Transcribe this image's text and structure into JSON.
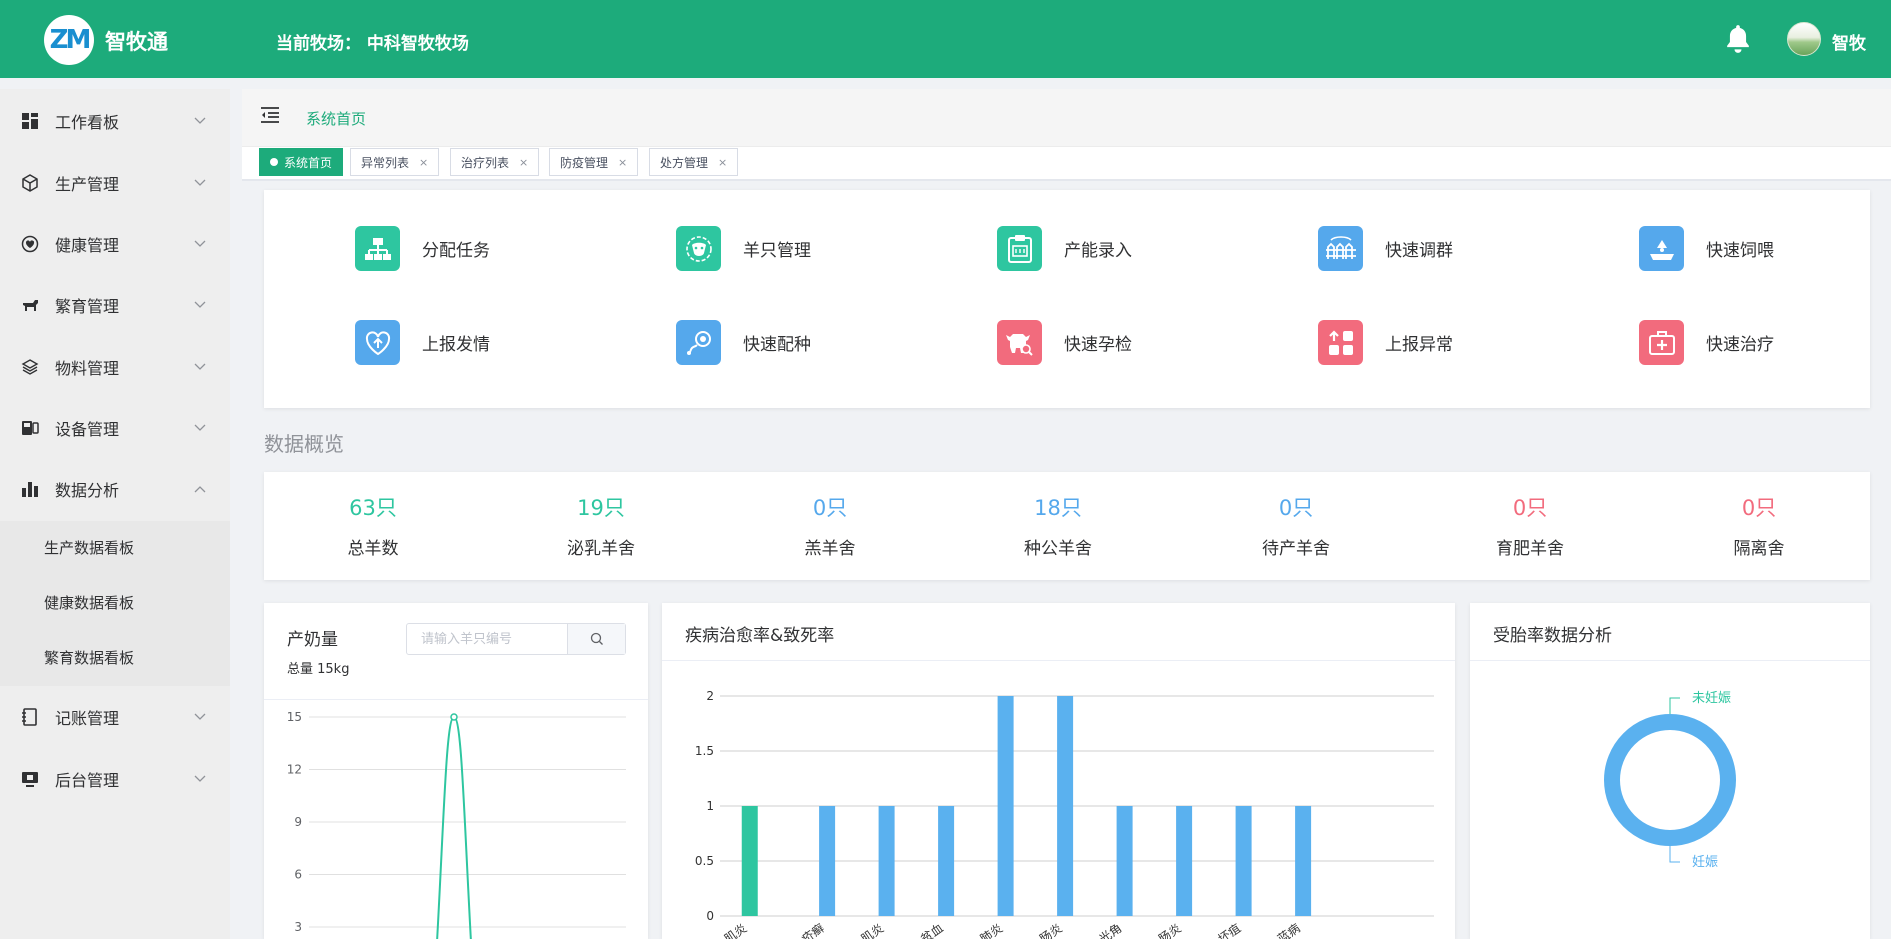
{
  "header": {
    "logo_text": "ZM",
    "app_name": "智牧通",
    "farm_label": "当前牧场：",
    "farm_name": "中科智牧牧场",
    "user_name": "智牧"
  },
  "sidebar": {
    "items": [
      {
        "label": "工作看板",
        "icon": "dashboard-icon"
      },
      {
        "label": "生产管理",
        "icon": "box-icon"
      },
      {
        "label": "健康管理",
        "icon": "heart-shield-icon"
      },
      {
        "label": "繁育管理",
        "icon": "sheep-icon"
      },
      {
        "label": "物料管理",
        "icon": "layers-icon"
      },
      {
        "label": "设备管理",
        "icon": "device-icon"
      },
      {
        "label": "数据分析",
        "icon": "bar-chart-icon"
      },
      {
        "label": "记账管理",
        "icon": "notebook-icon"
      },
      {
        "label": "后台管理",
        "icon": "monitor-icon"
      }
    ],
    "submenu": [
      "生产数据看板",
      "健康数据看板",
      "繁育数据看板"
    ]
  },
  "breadcrumb": "系统首页",
  "tabs": [
    {
      "label": "系统首页",
      "active": true
    },
    {
      "label": "异常列表"
    },
    {
      "label": "治疗列表"
    },
    {
      "label": "防疫管理"
    },
    {
      "label": "处方管理"
    }
  ],
  "quick_actions": [
    {
      "label": "分配任务",
      "color": "g",
      "icon": "org-chart-icon"
    },
    {
      "label": "羊只管理",
      "color": "g",
      "icon": "sheep-face-icon"
    },
    {
      "label": "产能录入",
      "color": "g",
      "icon": "clipboard-icon"
    },
    {
      "label": "快速调群",
      "color": "b",
      "icon": "fence-icon"
    },
    {
      "label": "快速饲喂",
      "color": "b",
      "icon": "feed-icon"
    },
    {
      "label": "上报发情",
      "color": "b",
      "icon": "heart-icon"
    },
    {
      "label": "快速配种",
      "color": "b",
      "icon": "sperm-icon"
    },
    {
      "label": "快速孕检",
      "color": "r",
      "icon": "cow-icon"
    },
    {
      "label": "上报异常",
      "color": "r",
      "icon": "grid-upload-icon"
    },
    {
      "label": "快速治疗",
      "color": "r",
      "icon": "medkit-icon"
    }
  ],
  "overview_title": "数据概览",
  "stats": [
    {
      "value": "63",
      "unit": "只",
      "label": "总羊数",
      "color": "#2ec6a0"
    },
    {
      "value": "19",
      "unit": "只",
      "label": "泌乳羊舍",
      "color": "#2ec6a0"
    },
    {
      "value": "0",
      "unit": "只",
      "label": "羔羊舍",
      "color": "#55a8ec"
    },
    {
      "value": "18",
      "unit": "只",
      "label": "种公羊舍",
      "color": "#55a8ec"
    },
    {
      "value": "0",
      "unit": "只",
      "label": "待产羊舍",
      "color": "#55a8ec"
    },
    {
      "value": "0",
      "unit": "只",
      "label": "育肥羊舍",
      "color": "#f26b7d"
    },
    {
      "value": "0",
      "unit": "只",
      "label": "隔离舍",
      "color": "#f26b7d"
    }
  ],
  "milk_panel": {
    "title": "产奶量",
    "search_placeholder": "请输入羊只编号",
    "total": "总量 15kg"
  },
  "disease_panel": {
    "title": "疾病治愈率&致死率"
  },
  "preg_panel": {
    "title": "受胎率数据分析"
  },
  "chart_data": [
    {
      "type": "line",
      "title": "产奶量",
      "y_ticks": [
        15,
        12,
        9,
        6,
        3
      ],
      "ylim": [
        0,
        15
      ],
      "peak_value": 15,
      "series_color": "#2ec6a0"
    },
    {
      "type": "bar",
      "title": "疾病治愈率&致死率",
      "y_ticks": [
        2,
        1.5,
        1,
        0.5,
        0
      ],
      "ylim": [
        0,
        2
      ],
      "categories": [
        "肌炎",
        "疥癣",
        "肌炎",
        "贫血",
        "肺炎",
        "肠炎",
        "光角",
        "肠炎",
        "坏疽",
        "蓝病"
      ],
      "values": [
        1,
        1,
        1,
        1,
        2,
        2,
        1,
        1,
        1,
        1
      ],
      "highlight_index": 0,
      "colors": {
        "bar": "#5ab1ef",
        "highlight": "#2ec6a0"
      }
    },
    {
      "type": "pie",
      "title": "受胎率数据分析",
      "slices": [
        {
          "name": "未妊娠",
          "value": 0,
          "color": "#2ec6a0"
        },
        {
          "name": "妊娠",
          "value": 1,
          "color": "#5ab1ef"
        }
      ]
    }
  ]
}
